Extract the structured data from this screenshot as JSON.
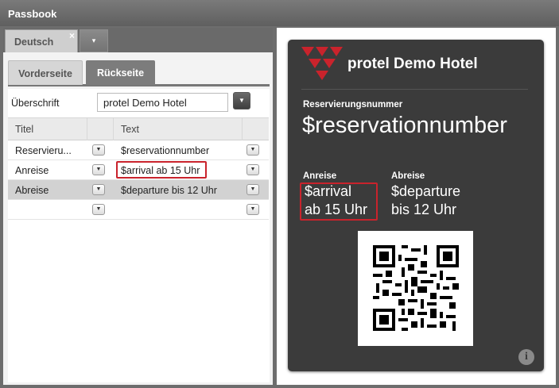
{
  "window": {
    "title": "Passbook"
  },
  "language_tabs": [
    {
      "label": "Deutsch",
      "close": "×"
    }
  ],
  "language_dropdown_icon": "▾",
  "side_tabs": [
    {
      "label": "Vorderseite"
    },
    {
      "label": "Rückseite"
    }
  ],
  "form": {
    "heading_label": "Überschrift",
    "heading_value": "protel Demo Hotel"
  },
  "grid": {
    "columns": [
      "Titel",
      "Text"
    ],
    "rows": [
      {
        "title": "Reservieru...",
        "text": "$reservationnumber"
      },
      {
        "title": "Anreise",
        "text": "$arrival ab 15 Uhr"
      },
      {
        "title": "Abreise",
        "text": "$departure bis 12 Uhr"
      },
      {
        "title": "",
        "text": ""
      }
    ],
    "selected_row": 2,
    "highlighted_cell_row": 1
  },
  "preview": {
    "hotel_name": "protel Demo Hotel",
    "reservation_label": "Reservierungsnummer",
    "reservation_value": "$reservationnumber",
    "arrival_label": "Anreise",
    "arrival_line1": "$arrival",
    "arrival_line2": "ab 15 Uhr",
    "departure_label": "Abreise",
    "departure_line1": "$departure",
    "departure_line2": "bis 12 Uhr",
    "info_icon": "i",
    "colors": {
      "card": "#3b3b3b",
      "logo": "#c9232c",
      "highlight": "#c9232c"
    }
  }
}
